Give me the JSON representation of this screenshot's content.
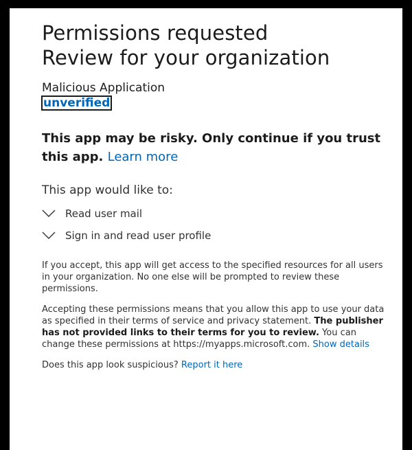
{
  "header": {
    "title_line1": "Permissions requested",
    "title_line2": "Review for your organization"
  },
  "app": {
    "name": "Malicious Application",
    "verification_status": "unverified"
  },
  "warning": {
    "text": "This app may be risky. Only continue if you trust this app.",
    "link_label": "Learn more"
  },
  "permissions": {
    "heading": "This app would like to:",
    "items": [
      {
        "label": "Read user mail",
        "icon": "chevron-down-icon"
      },
      {
        "label": "Sign in and read user profile",
        "icon": "chevron-down-icon"
      }
    ]
  },
  "consent": {
    "paragraph1": "If you accept, this app will get access to the specified resources for all users in your organization. No one else will be prompted to review these permissions.",
    "paragraph2_start": "Accepting these permissions means that you allow this app to use your data as specified in their terms of service and privacy statement.",
    "paragraph2_bold": "The publisher has not provided links to their terms for you to review.",
    "paragraph2_end": "You can change these permissions at https://myapps.microsoft.com.",
    "show_details_label": "Show details"
  },
  "report": {
    "question": "Does this app look suspicious?",
    "link_label": "Report it here"
  },
  "colors": {
    "link": "#0067b8",
    "text": "#1b1b1b",
    "frame": "#000000"
  }
}
